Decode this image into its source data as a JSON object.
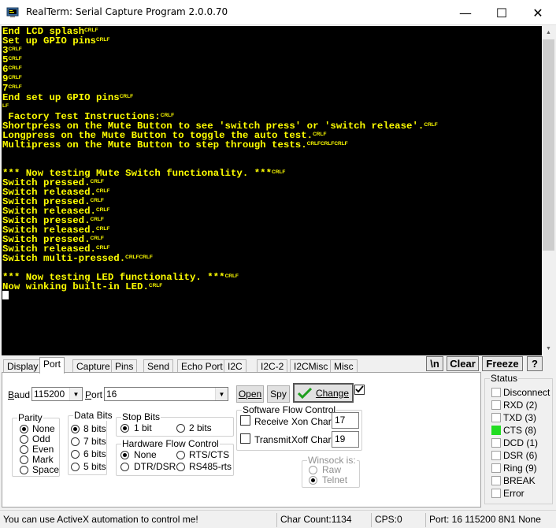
{
  "window": {
    "title": "RealTerm: Serial Capture Program 2.0.0.70",
    "minimize": "—",
    "maximize": "☐",
    "close": "✕"
  },
  "terminal": {
    "lines": [
      [
        {
          "t": "End LCD splash"
        },
        {
          "c": "CRLF"
        }
      ],
      [
        {
          "t": "Set up GPIO pins"
        },
        {
          "c": "CRLF"
        }
      ],
      [
        {
          "t": "3"
        },
        {
          "c": "CRLF"
        }
      ],
      [
        {
          "t": "5"
        },
        {
          "c": "CRLF"
        }
      ],
      [
        {
          "t": "6"
        },
        {
          "c": "CRLF"
        }
      ],
      [
        {
          "t": "9"
        },
        {
          "c": "CRLF"
        }
      ],
      [
        {
          "t": "7"
        },
        {
          "c": "CRLF"
        }
      ],
      [
        {
          "t": "End set up GPIO pins"
        },
        {
          "c": "CRLF"
        }
      ],
      [
        {
          "c": "LF"
        }
      ],
      [
        {
          "t": " Factory Test Instructions:"
        },
        {
          "c": "CRLF"
        }
      ],
      [
        {
          "t": "Shortpress on the Mute Button to see 'switch press' or 'switch release'."
        },
        {
          "c": "CRLF"
        }
      ],
      [
        {
          "t": "Longpress on the Mute Button to toggle the auto test."
        },
        {
          "c": "CRLF"
        }
      ],
      [
        {
          "t": "Multipress on the Mute Button to step through tests."
        },
        {
          "c": "CRLFCRLFCRLF"
        }
      ],
      [],
      [],
      [
        {
          "t": "*** Now testing Mute Switch functionality. ***"
        },
        {
          "c": "CRLF"
        }
      ],
      [
        {
          "t": "Switch pressed."
        },
        {
          "c": "CRLF"
        }
      ],
      [
        {
          "t": "Switch released."
        },
        {
          "c": "CRLF"
        }
      ],
      [
        {
          "t": "Switch pressed."
        },
        {
          "c": "CRLF"
        }
      ],
      [
        {
          "t": "Switch released."
        },
        {
          "c": "CRLF"
        }
      ],
      [
        {
          "t": "Switch pressed."
        },
        {
          "c": "CRLF"
        }
      ],
      [
        {
          "t": "Switch released."
        },
        {
          "c": "CRLF"
        }
      ],
      [
        {
          "t": "Switch pressed."
        },
        {
          "c": "CRLF"
        }
      ],
      [
        {
          "t": "Switch released."
        },
        {
          "c": "CRLF"
        }
      ],
      [
        {
          "t": "Switch multi-pressed."
        },
        {
          "c": "CRLFCRLF"
        }
      ],
      [],
      [
        {
          "t": "*** Now testing LED functionality. ***"
        },
        {
          "c": "CRLF"
        }
      ],
      [
        {
          "t": "Now winking built-in LED."
        },
        {
          "c": "CRLF"
        }
      ],
      [
        {
          "cursor": true
        }
      ]
    ]
  },
  "tabs": [
    "Display",
    "Port",
    "Capture",
    "Pins",
    "Send",
    "Echo Port",
    "I2C",
    "I2C-2",
    "I2CMisc",
    "Misc"
  ],
  "active_tab": "Port",
  "toolbar": {
    "newline_btn": "\\n",
    "clear_btn": "Clear",
    "freeze_btn": "Freeze",
    "help_btn": "?"
  },
  "port": {
    "baud_label": "Baud",
    "baud_value": "115200",
    "port_label": "Port",
    "port_value": "16",
    "open_btn": "Open",
    "spy_btn": "Spy",
    "change_btn": "Change",
    "parity": {
      "label": "Parity",
      "options": [
        "None",
        "Odd",
        "Even",
        "Mark",
        "Space"
      ],
      "selected": "None"
    },
    "data_bits": {
      "label": "Data Bits",
      "options": [
        "8 bits",
        "7 bits",
        "6 bits",
        "5 bits"
      ],
      "selected": "8 bits"
    },
    "stop_bits": {
      "label": "Stop Bits",
      "options": [
        "1 bit",
        "2 bits"
      ],
      "selected": "1 bit"
    },
    "hw_flow": {
      "label": "Hardware Flow Control",
      "options": [
        "None",
        "RTS/CTS",
        "DTR/DSR",
        "RS485-rts"
      ],
      "selected": "None"
    },
    "sw_flow": {
      "label": "Software Flow Control",
      "receive": "Receive",
      "transmit": "Transmit",
      "xon_label": "Xon Char:",
      "xon_value": "17",
      "xoff_label": "Xoff Char:",
      "xoff_value": "19"
    },
    "winsock": {
      "label": "Winsock is:",
      "options": [
        "Raw",
        "Telnet"
      ],
      "selected": "Telnet"
    }
  },
  "status": {
    "label": "Status",
    "items": [
      {
        "name": "Disconnect",
        "on": false
      },
      {
        "name": "RXD (2)",
        "on": false
      },
      {
        "name": "TXD (3)",
        "on": false
      },
      {
        "name": "CTS (8)",
        "on": true
      },
      {
        "name": "DCD (1)",
        "on": false
      },
      {
        "name": "DSR (6)",
        "on": false
      },
      {
        "name": "Ring (9)",
        "on": false
      },
      {
        "name": "BREAK",
        "on": false
      },
      {
        "name": "Error",
        "on": false
      }
    ],
    "led_on_color": "#22dd22"
  },
  "statusbar": {
    "message": "You can use ActiveX automation to control me!",
    "char_count": "Char Count:1134",
    "cps": "CPS:0",
    "port_info": "Port: 16 115200 8N1 None"
  },
  "colors": {
    "terminal_bg": "#000000",
    "terminal_fg": "#ffff00",
    "change_check": "#1e9e1e"
  }
}
